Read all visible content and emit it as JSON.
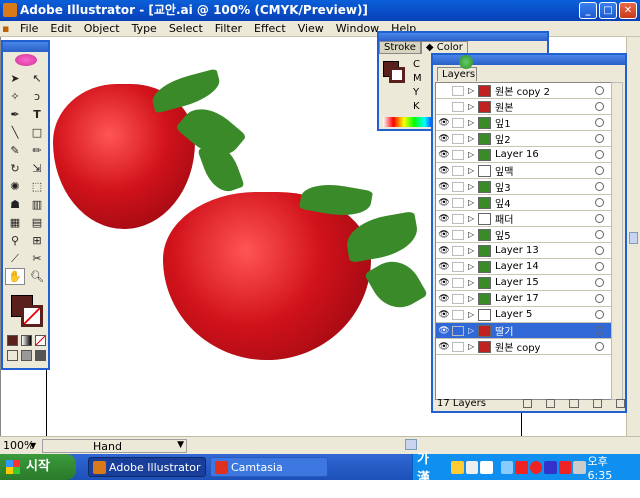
{
  "window": {
    "title": "Adobe Illustrator - [교안.ai @ 100% (CMYK/Preview)]"
  },
  "menu": [
    "File",
    "Edit",
    "Object",
    "Type",
    "Select",
    "Filter",
    "Effect",
    "View",
    "Window",
    "Help"
  ],
  "status": {
    "zoom": "100%",
    "tool": "Hand"
  },
  "color_panel": {
    "tabs": [
      "Stroke",
      "Color"
    ],
    "channels": [
      "C",
      "M",
      "Y",
      "K"
    ],
    "fill_color": "#5a201c"
  },
  "layers_panel": {
    "tab": "Layers",
    "footer": "17 Layers",
    "rows": [
      {
        "name": "원본 copy 2",
        "visible": false,
        "thumb": "#c02020"
      },
      {
        "name": "원본",
        "visible": false,
        "thumb": "#c02020"
      },
      {
        "name": "잎1",
        "visible": true,
        "thumb": "#3a8a2a"
      },
      {
        "name": "잎2",
        "visible": true,
        "thumb": "#3a8a2a"
      },
      {
        "name": "Layer 16",
        "visible": true,
        "thumb": "#3a8a2a"
      },
      {
        "name": "잎맥",
        "visible": true,
        "thumb": "#ffffff"
      },
      {
        "name": "잎3",
        "visible": true,
        "thumb": "#3a8a2a"
      },
      {
        "name": "잎4",
        "visible": true,
        "thumb": "#3a8a2a"
      },
      {
        "name": "패더",
        "visible": true,
        "thumb": "#ffffff"
      },
      {
        "name": "잎5",
        "visible": true,
        "thumb": "#3a8a2a"
      },
      {
        "name": "Layer 13",
        "visible": true,
        "thumb": "#3a8a2a"
      },
      {
        "name": "Layer 14",
        "visible": true,
        "thumb": "#3a8a2a"
      },
      {
        "name": "Layer 15",
        "visible": true,
        "thumb": "#3a8a2a"
      },
      {
        "name": "Layer 17",
        "visible": true,
        "thumb": "#3a8a2a"
      },
      {
        "name": "Layer 5",
        "visible": true,
        "thumb": "#ffffff"
      },
      {
        "name": "딸기",
        "visible": true,
        "thumb": "#c02020",
        "selected": true
      },
      {
        "name": "원본 copy",
        "visible": true,
        "thumb": "#c02020"
      }
    ]
  },
  "taskbar": {
    "start": "시작",
    "tasks": [
      "Adobe Illustrator -...",
      "Camtasia Record..."
    ],
    "ime": "가 漢",
    "clock": "오후 6:35"
  }
}
